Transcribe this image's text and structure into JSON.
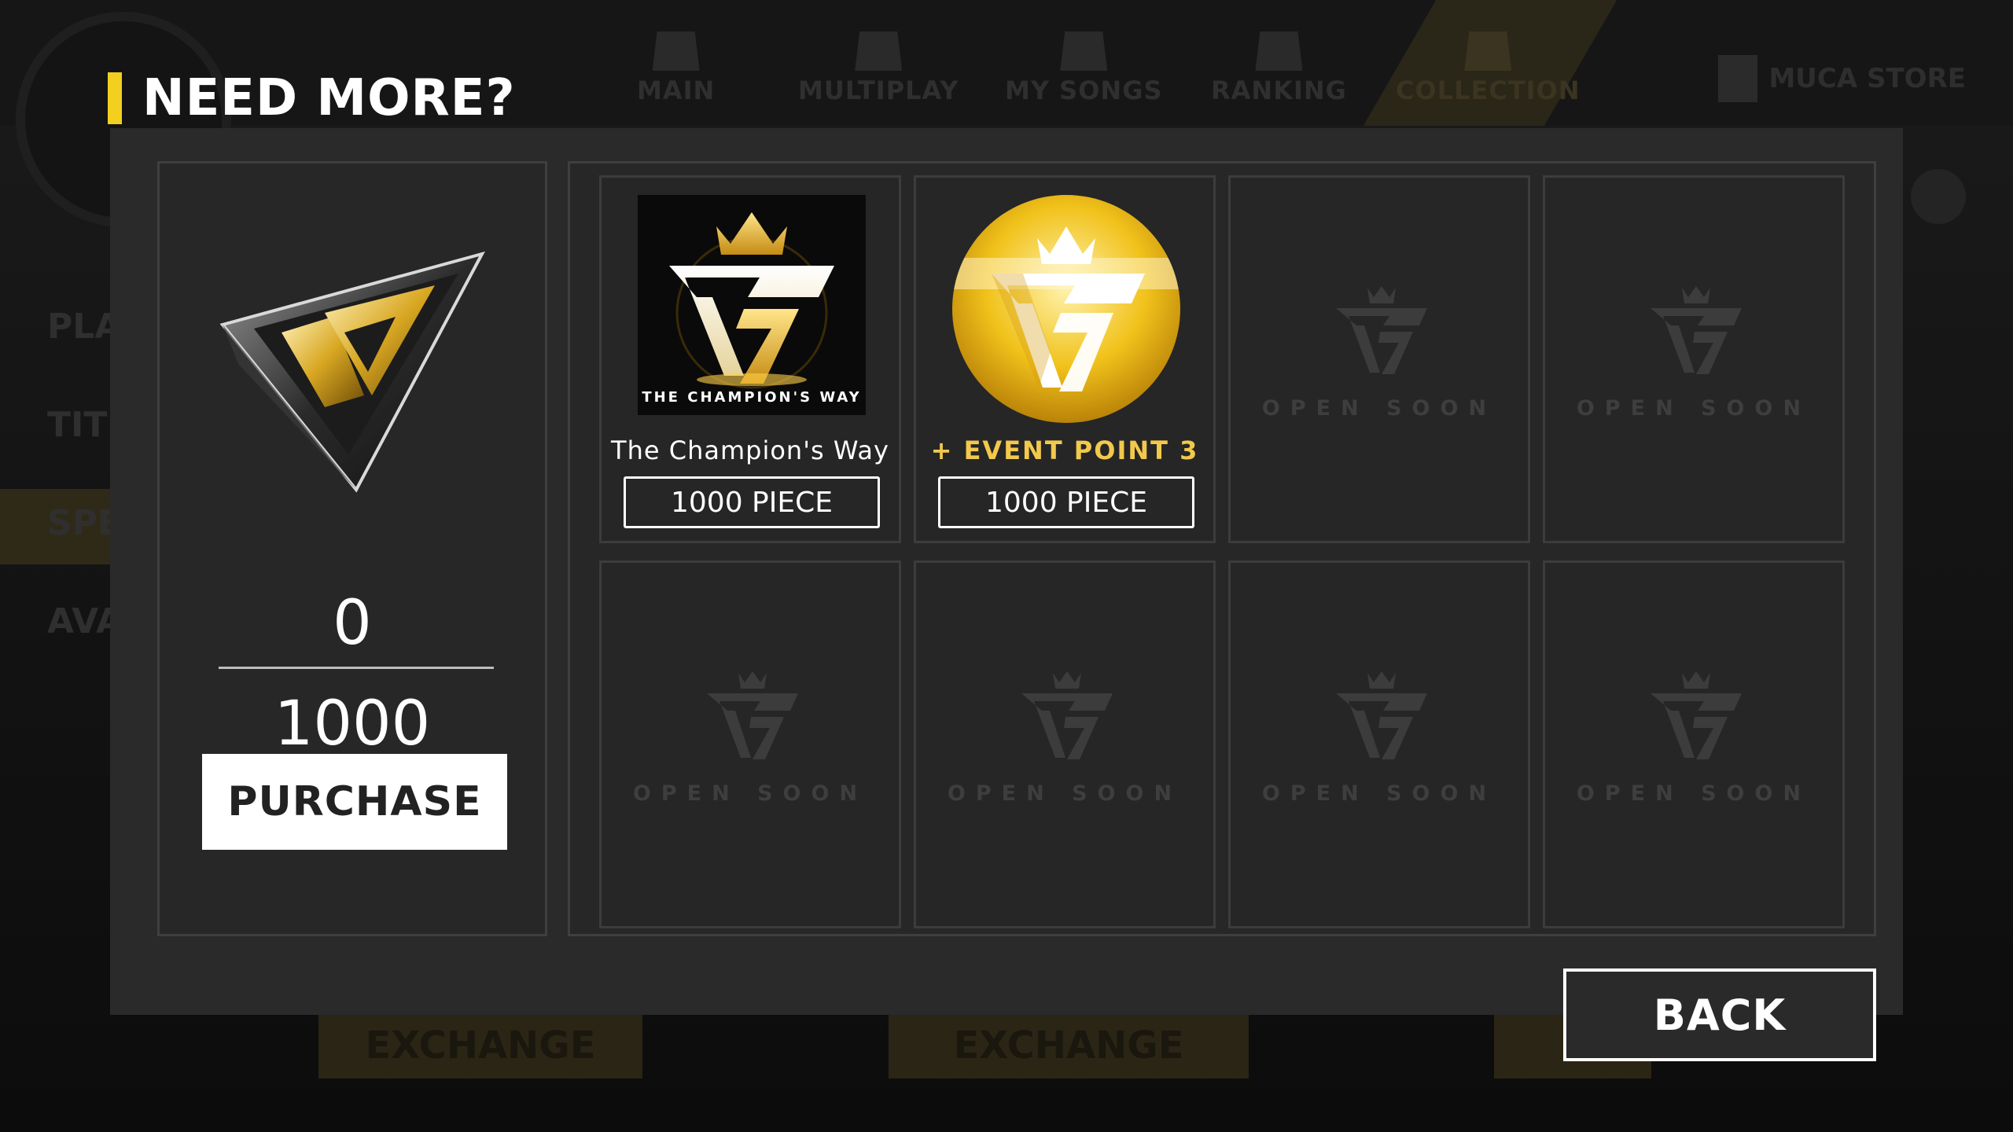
{
  "background": {
    "nav": [
      "MAIN",
      "MULTIPLAY",
      "MY SONGS",
      "RANKING",
      "COLLECTION"
    ],
    "store_label": "MUCA STORE",
    "side_items": [
      "PLA",
      "TITL",
      "SPE",
      "AVA"
    ],
    "exchange_labels": [
      "EXCHANGE",
      "EXCHANGE"
    ]
  },
  "dialog": {
    "title": "NEED MORE?",
    "owned": "0",
    "required": "1000",
    "purchase_label": "PURCHASE",
    "back_label": "BACK"
  },
  "items": [
    {
      "name": "The Champion's Way",
      "price": "1000 PIECE",
      "caption": "THE CHAMPION'S WAY",
      "type": "title"
    },
    {
      "name": "+ EVENT POINT 3",
      "price": "1000 PIECE",
      "type": "event"
    }
  ],
  "open_soon_label": "OPEN SOON",
  "colors": {
    "accent": "#f3cf1f",
    "gold_text": "#f2c94c",
    "panel": "#2a2a2a"
  }
}
